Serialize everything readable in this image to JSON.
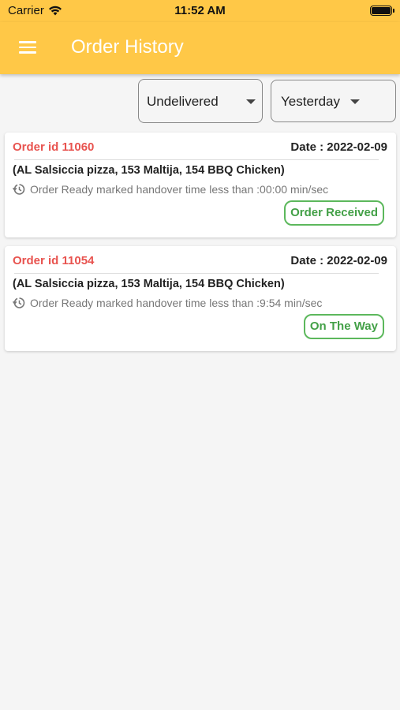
{
  "status_bar": {
    "carrier": "Carrier",
    "time": "11:52 AM",
    "wifi_icon": "wifi-icon",
    "battery_icon": "battery-icon"
  },
  "app_bar": {
    "title": "Order History",
    "menu_icon": "hamburger-menu-icon",
    "color": "#ffc847"
  },
  "filters": {
    "status": {
      "selected": "Undelivered"
    },
    "date": {
      "selected": "Yesterday"
    }
  },
  "orders": [
    {
      "order_id": "Order id 11060",
      "date": "Date : 2022-02-09",
      "items": "(AL Salsiccia pizza, 153 Maltija, 154 BBQ Chicken)",
      "note": "Order Ready marked handover time less than :00:00 min/sec",
      "status": "Order Received"
    },
    {
      "order_id": "Order id 11054",
      "date": "Date : 2022-02-09",
      "items": "(AL Salsiccia pizza, 153 Maltija, 154 BBQ Chicken)",
      "note": "Order Ready marked handover time less than :9:54 min/sec",
      "status": "On The Way"
    }
  ],
  "colors": {
    "order_id": "#e8534f",
    "status_green": "#43a047",
    "background": "#f5f5f5"
  }
}
